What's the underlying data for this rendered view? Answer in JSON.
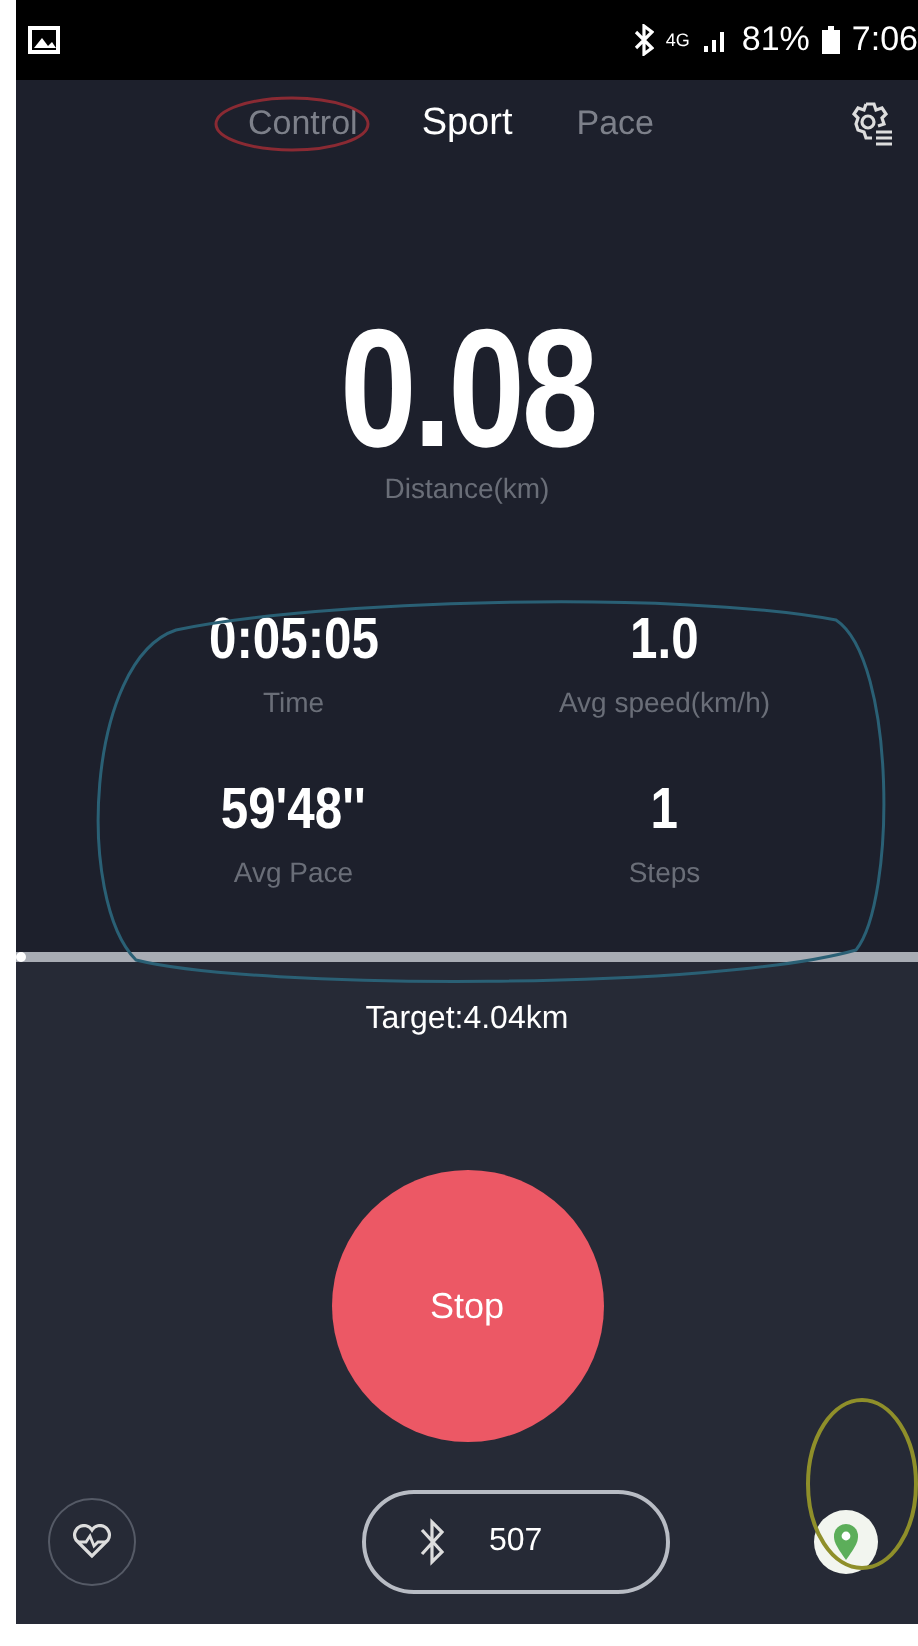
{
  "status_bar": {
    "battery": "81%",
    "time": "7:06",
    "network": "4G"
  },
  "tabs": [
    {
      "label": "Control",
      "selected": false
    },
    {
      "label": "Sport",
      "selected": true
    },
    {
      "label": "Pace",
      "selected": false
    }
  ],
  "distance": {
    "value": "0.08",
    "label": "Distance(km)"
  },
  "stats": [
    {
      "value": "0:05:05",
      "label": "Time"
    },
    {
      "value": "1.0",
      "label": "Avg speed(km/h)"
    },
    {
      "value": "59'48''",
      "label": "Avg Pace"
    },
    {
      "value": "1",
      "label": "Steps"
    }
  ],
  "progress": {
    "level": 0.01
  },
  "target": "Target:4.04km",
  "stop_button": "Stop",
  "device": {
    "count": "507"
  }
}
